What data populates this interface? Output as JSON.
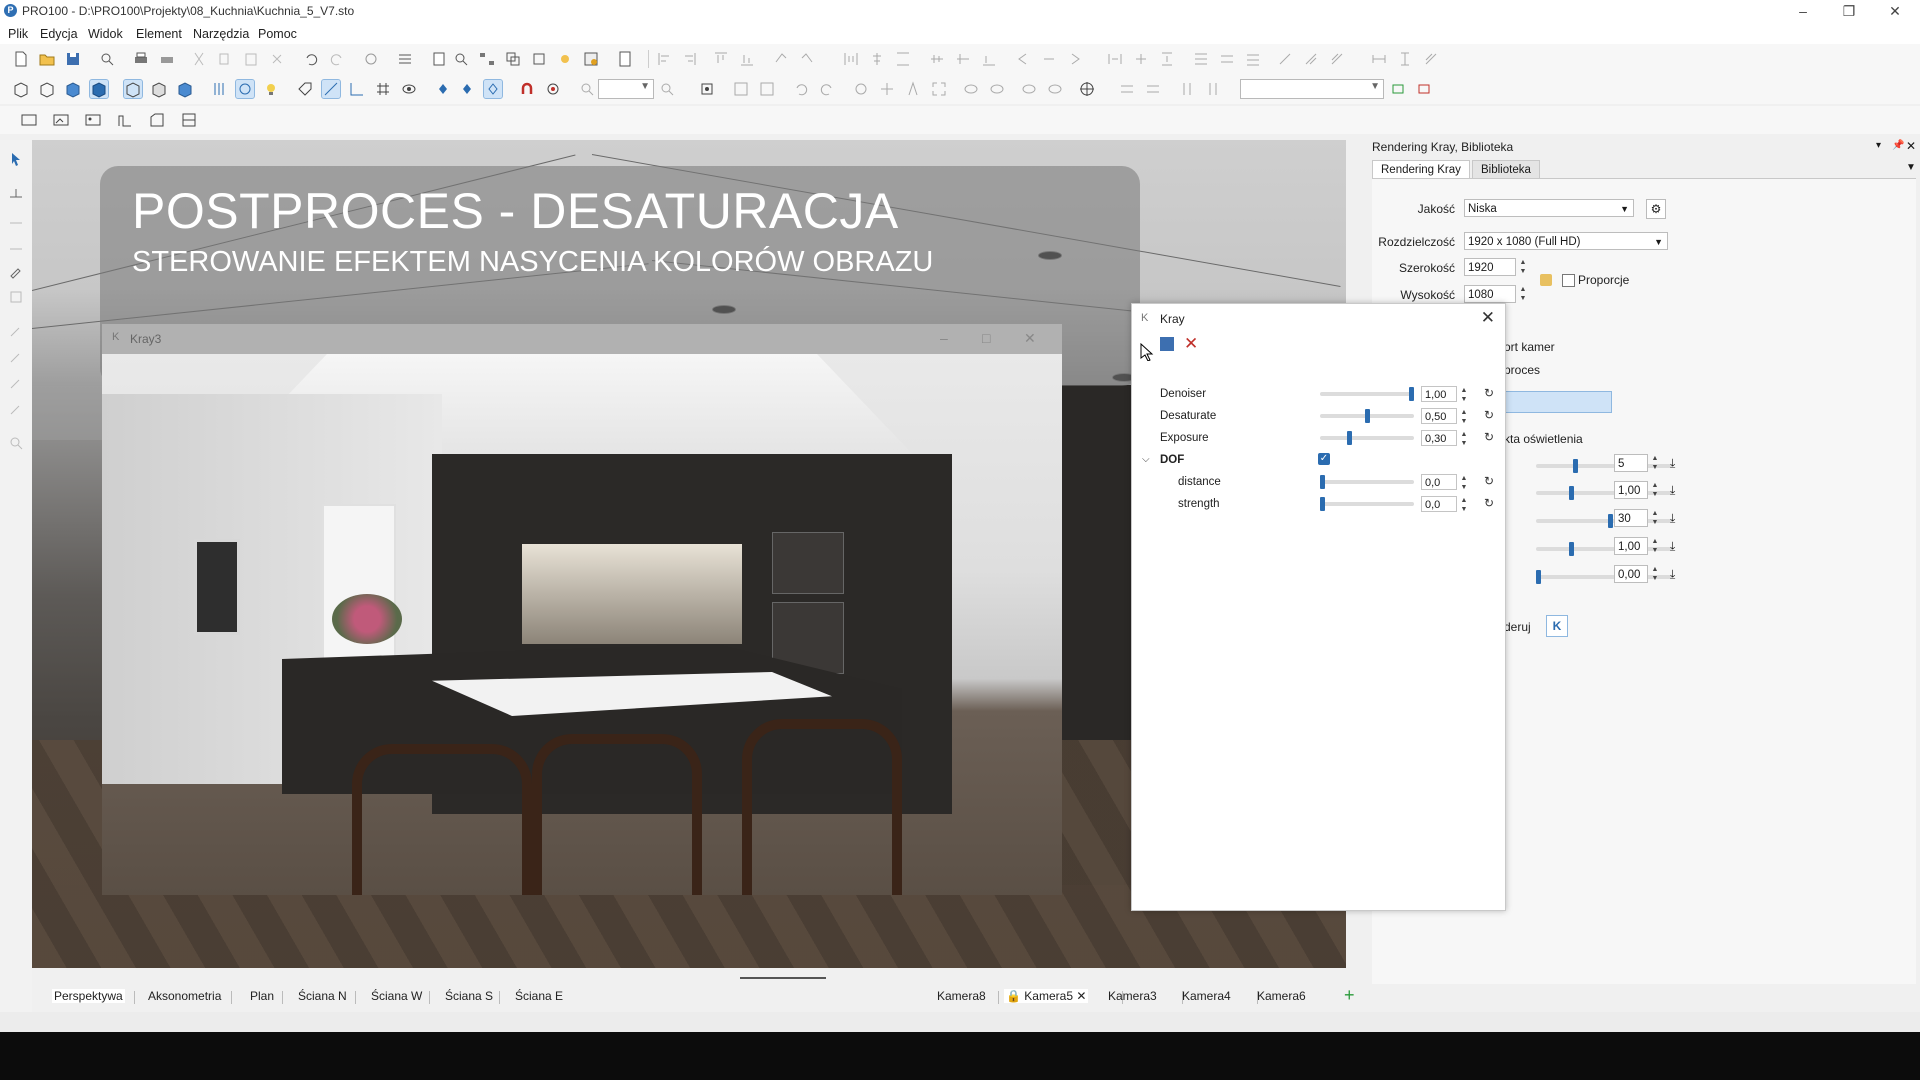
{
  "window": {
    "title": "PRO100 - D:\\PRO100\\Projekty\\08_Kuchnia\\Kuchnia_5_V7.sto",
    "app_icon": "P"
  },
  "menu": {
    "items": [
      "Plik",
      "Edycja",
      "Widok",
      "Element",
      "Narzędzia",
      "Pomoc"
    ]
  },
  "toolbar": {
    "zoom_value": "",
    "view_select_value": ""
  },
  "overlay": {
    "title": "POSTPROCES - DESATURACJA",
    "subtitle": "STEROWANIE EFEKTEM NASYCENIA KOLORÓW OBRAZU"
  },
  "render_window": {
    "title": "Kray3"
  },
  "right_panel": {
    "header": "Rendering Kray, Biblioteka",
    "tabs": [
      "Rendering Kray",
      "Biblioteka"
    ],
    "fields": {
      "quality_label": "Jakość",
      "quality_value": "Niska",
      "resolution_label": "Rozdzielczość",
      "resolution_value": "1920 x 1080 (Full HD)",
      "width_label": "Szerokość",
      "width_value": "1920",
      "height_label": "Wysokość",
      "height_value": "1080",
      "proportions_label": "Proporcje",
      "cameras_partial": "ort kamer",
      "postproc_partial": "proces",
      "lighting_partial": "kta oświetlenia",
      "render_partial": "deruj"
    },
    "values": [
      "5",
      "1,00",
      "30",
      "1,00",
      "0,00"
    ],
    "slider_levels": [
      0.28,
      0.25,
      0.55,
      0.25,
      0.0
    ]
  },
  "kray_dialog": {
    "title": "Kray",
    "params": [
      {
        "label": "Denoiser",
        "value": "1,00",
        "level": 1.0
      },
      {
        "label": "Desaturate",
        "value": "0,50",
        "level": 0.5
      },
      {
        "label": "Exposure",
        "value": "0,30",
        "level": 0.3
      }
    ],
    "dof": {
      "label": "DOF",
      "checked": true,
      "params": [
        {
          "label": "distance",
          "value": "0,0",
          "level": 0.0
        },
        {
          "label": "strength",
          "value": "0,0",
          "level": 0.0
        }
      ]
    }
  },
  "bottom_tabs": {
    "views": [
      "Perspektywa",
      "Aksonometria",
      "Plan",
      "Ściana N",
      "Ściana W",
      "Ściana S",
      "Ściana E"
    ],
    "cameras": [
      "Kamera8",
      "Kamera5",
      "Kamera3",
      "Kamera4",
      "Kamera6"
    ],
    "active_view": "Perspektywa",
    "active_camera": "Kamera5"
  },
  "colors": {
    "accent": "#2b6cb0",
    "overlay_card": "#787878"
  }
}
